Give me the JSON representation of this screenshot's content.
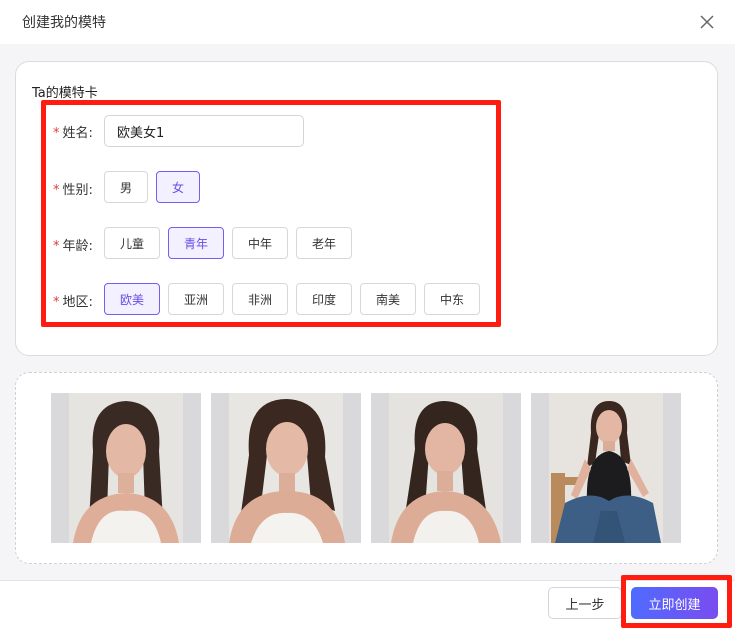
{
  "dialog": {
    "title": "创建我的模特",
    "close_icon": "close-icon"
  },
  "card": {
    "title": "Ta的模特卡",
    "required_mark": "*",
    "name": {
      "label": "姓名:",
      "value": "欧美女1"
    },
    "gender": {
      "label": "性别:",
      "options": [
        "男",
        "女"
      ],
      "selected": "女"
    },
    "age": {
      "label": "年龄:",
      "options": [
        "儿童",
        "青年",
        "中年",
        "老年"
      ],
      "selected": "青年"
    },
    "region": {
      "label": "地区:",
      "options": [
        "欧美",
        "亚洲",
        "非洲",
        "印度",
        "南美",
        "中东"
      ],
      "selected": "欧美"
    }
  },
  "gallery": {
    "photos": [
      "model-photo-1",
      "model-photo-2",
      "model-photo-3",
      "model-photo-4"
    ]
  },
  "footer": {
    "prev_label": "上一步",
    "create_label": "立即创建"
  },
  "colors": {
    "accent": "#7a5cf0",
    "highlight": "#ff1d12",
    "required": "#e03a3a"
  }
}
